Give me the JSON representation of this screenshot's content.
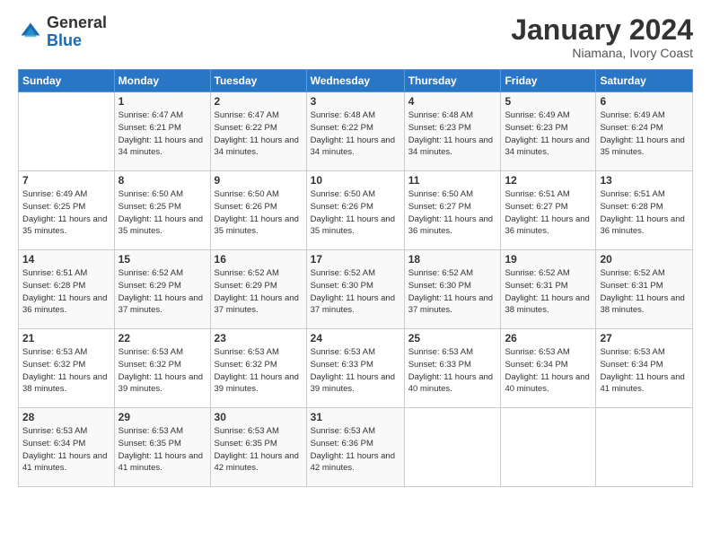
{
  "logo": {
    "general": "General",
    "blue": "Blue"
  },
  "title": "January 2024",
  "subtitle": "Niamana, Ivory Coast",
  "days_header": [
    "Sunday",
    "Monday",
    "Tuesday",
    "Wednesday",
    "Thursday",
    "Friday",
    "Saturday"
  ],
  "weeks": [
    [
      {
        "day": "",
        "sunrise": "",
        "sunset": "",
        "daylight": ""
      },
      {
        "day": "1",
        "sunrise": "Sunrise: 6:47 AM",
        "sunset": "Sunset: 6:21 PM",
        "daylight": "Daylight: 11 hours and 34 minutes."
      },
      {
        "day": "2",
        "sunrise": "Sunrise: 6:47 AM",
        "sunset": "Sunset: 6:22 PM",
        "daylight": "Daylight: 11 hours and 34 minutes."
      },
      {
        "day": "3",
        "sunrise": "Sunrise: 6:48 AM",
        "sunset": "Sunset: 6:22 PM",
        "daylight": "Daylight: 11 hours and 34 minutes."
      },
      {
        "day": "4",
        "sunrise": "Sunrise: 6:48 AM",
        "sunset": "Sunset: 6:23 PM",
        "daylight": "Daylight: 11 hours and 34 minutes."
      },
      {
        "day": "5",
        "sunrise": "Sunrise: 6:49 AM",
        "sunset": "Sunset: 6:23 PM",
        "daylight": "Daylight: 11 hours and 34 minutes."
      },
      {
        "day": "6",
        "sunrise": "Sunrise: 6:49 AM",
        "sunset": "Sunset: 6:24 PM",
        "daylight": "Daylight: 11 hours and 35 minutes."
      }
    ],
    [
      {
        "day": "7",
        "sunrise": "Sunrise: 6:49 AM",
        "sunset": "Sunset: 6:25 PM",
        "daylight": "Daylight: 11 hours and 35 minutes."
      },
      {
        "day": "8",
        "sunrise": "Sunrise: 6:50 AM",
        "sunset": "Sunset: 6:25 PM",
        "daylight": "Daylight: 11 hours and 35 minutes."
      },
      {
        "day": "9",
        "sunrise": "Sunrise: 6:50 AM",
        "sunset": "Sunset: 6:26 PM",
        "daylight": "Daylight: 11 hours and 35 minutes."
      },
      {
        "day": "10",
        "sunrise": "Sunrise: 6:50 AM",
        "sunset": "Sunset: 6:26 PM",
        "daylight": "Daylight: 11 hours and 35 minutes."
      },
      {
        "day": "11",
        "sunrise": "Sunrise: 6:50 AM",
        "sunset": "Sunset: 6:27 PM",
        "daylight": "Daylight: 11 hours and 36 minutes."
      },
      {
        "day": "12",
        "sunrise": "Sunrise: 6:51 AM",
        "sunset": "Sunset: 6:27 PM",
        "daylight": "Daylight: 11 hours and 36 minutes."
      },
      {
        "day": "13",
        "sunrise": "Sunrise: 6:51 AM",
        "sunset": "Sunset: 6:28 PM",
        "daylight": "Daylight: 11 hours and 36 minutes."
      }
    ],
    [
      {
        "day": "14",
        "sunrise": "Sunrise: 6:51 AM",
        "sunset": "Sunset: 6:28 PM",
        "daylight": "Daylight: 11 hours and 36 minutes."
      },
      {
        "day": "15",
        "sunrise": "Sunrise: 6:52 AM",
        "sunset": "Sunset: 6:29 PM",
        "daylight": "Daylight: 11 hours and 37 minutes."
      },
      {
        "day": "16",
        "sunrise": "Sunrise: 6:52 AM",
        "sunset": "Sunset: 6:29 PM",
        "daylight": "Daylight: 11 hours and 37 minutes."
      },
      {
        "day": "17",
        "sunrise": "Sunrise: 6:52 AM",
        "sunset": "Sunset: 6:30 PM",
        "daylight": "Daylight: 11 hours and 37 minutes."
      },
      {
        "day": "18",
        "sunrise": "Sunrise: 6:52 AM",
        "sunset": "Sunset: 6:30 PM",
        "daylight": "Daylight: 11 hours and 37 minutes."
      },
      {
        "day": "19",
        "sunrise": "Sunrise: 6:52 AM",
        "sunset": "Sunset: 6:31 PM",
        "daylight": "Daylight: 11 hours and 38 minutes."
      },
      {
        "day": "20",
        "sunrise": "Sunrise: 6:52 AM",
        "sunset": "Sunset: 6:31 PM",
        "daylight": "Daylight: 11 hours and 38 minutes."
      }
    ],
    [
      {
        "day": "21",
        "sunrise": "Sunrise: 6:53 AM",
        "sunset": "Sunset: 6:32 PM",
        "daylight": "Daylight: 11 hours and 38 minutes."
      },
      {
        "day": "22",
        "sunrise": "Sunrise: 6:53 AM",
        "sunset": "Sunset: 6:32 PM",
        "daylight": "Daylight: 11 hours and 39 minutes."
      },
      {
        "day": "23",
        "sunrise": "Sunrise: 6:53 AM",
        "sunset": "Sunset: 6:32 PM",
        "daylight": "Daylight: 11 hours and 39 minutes."
      },
      {
        "day": "24",
        "sunrise": "Sunrise: 6:53 AM",
        "sunset": "Sunset: 6:33 PM",
        "daylight": "Daylight: 11 hours and 39 minutes."
      },
      {
        "day": "25",
        "sunrise": "Sunrise: 6:53 AM",
        "sunset": "Sunset: 6:33 PM",
        "daylight": "Daylight: 11 hours and 40 minutes."
      },
      {
        "day": "26",
        "sunrise": "Sunrise: 6:53 AM",
        "sunset": "Sunset: 6:34 PM",
        "daylight": "Daylight: 11 hours and 40 minutes."
      },
      {
        "day": "27",
        "sunrise": "Sunrise: 6:53 AM",
        "sunset": "Sunset: 6:34 PM",
        "daylight": "Daylight: 11 hours and 41 minutes."
      }
    ],
    [
      {
        "day": "28",
        "sunrise": "Sunrise: 6:53 AM",
        "sunset": "Sunset: 6:34 PM",
        "daylight": "Daylight: 11 hours and 41 minutes."
      },
      {
        "day": "29",
        "sunrise": "Sunrise: 6:53 AM",
        "sunset": "Sunset: 6:35 PM",
        "daylight": "Daylight: 11 hours and 41 minutes."
      },
      {
        "day": "30",
        "sunrise": "Sunrise: 6:53 AM",
        "sunset": "Sunset: 6:35 PM",
        "daylight": "Daylight: 11 hours and 42 minutes."
      },
      {
        "day": "31",
        "sunrise": "Sunrise: 6:53 AM",
        "sunset": "Sunset: 6:36 PM",
        "daylight": "Daylight: 11 hours and 42 minutes."
      },
      {
        "day": "",
        "sunrise": "",
        "sunset": "",
        "daylight": ""
      },
      {
        "day": "",
        "sunrise": "",
        "sunset": "",
        "daylight": ""
      },
      {
        "day": "",
        "sunrise": "",
        "sunset": "",
        "daylight": ""
      }
    ]
  ]
}
